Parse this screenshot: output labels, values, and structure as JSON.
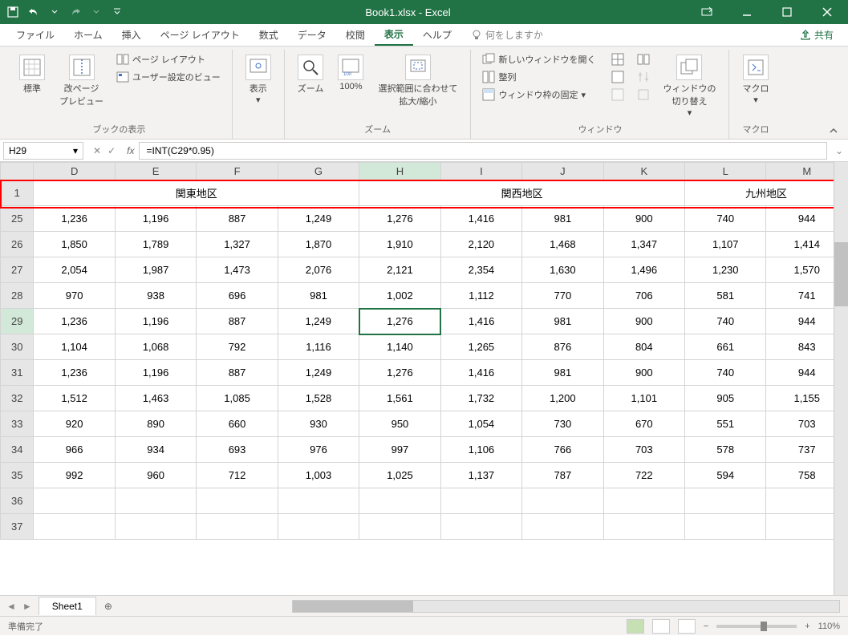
{
  "title": "Book1.xlsx - Excel",
  "menu": {
    "file": "ファイル",
    "home": "ホーム",
    "insert": "挿入",
    "pagelayout": "ページ レイアウト",
    "formulas": "数式",
    "data": "データ",
    "review": "校閲",
    "view": "表示",
    "help": "ヘルプ",
    "tellme": "何をしますか",
    "share": "共有"
  },
  "ribbon": {
    "normal": "標準",
    "pagebreak": "改ページ\nプレビュー",
    "pagelayout_btn": "ページ レイアウト",
    "custom_view": "ユーザー設定のビュー",
    "group_workbook": "ブックの表示",
    "show": "表示",
    "zoom": "ズーム",
    "hundred": "100%",
    "fit_selection": "選択範囲に合わせて\n拡大/縮小",
    "group_zoom": "ズーム",
    "new_window": "新しいウィンドウを開く",
    "arrange": "整列",
    "freeze": "ウィンドウ枠の固定",
    "group_window": "ウィンドウ",
    "switch_window": "ウィンドウの\n切り替え",
    "macro": "マクロ",
    "group_macro": "マクロ"
  },
  "namebox": "H29",
  "formula": "=INT(C29*0.95)",
  "columns": [
    "D",
    "E",
    "F",
    "G",
    "H",
    "I",
    "J",
    "K",
    "L",
    "M"
  ],
  "header_row": "1",
  "headers": {
    "kanto": "関東地区",
    "kansai": "関西地区",
    "kyushu": "九州地区"
  },
  "rows": [
    {
      "n": "25",
      "d": [
        "1,236",
        "1,196",
        "887",
        "1,249",
        "1,276",
        "1,416",
        "981",
        "900",
        "740",
        "944"
      ]
    },
    {
      "n": "26",
      "d": [
        "1,850",
        "1,789",
        "1,327",
        "1,870",
        "1,910",
        "2,120",
        "1,468",
        "1,347",
        "1,107",
        "1,414"
      ]
    },
    {
      "n": "27",
      "d": [
        "2,054",
        "1,987",
        "1,473",
        "2,076",
        "2,121",
        "2,354",
        "1,630",
        "1,496",
        "1,230",
        "1,570"
      ]
    },
    {
      "n": "28",
      "d": [
        "970",
        "938",
        "696",
        "981",
        "1,002",
        "1,112",
        "770",
        "706",
        "581",
        "741"
      ]
    },
    {
      "n": "29",
      "d": [
        "1,236",
        "1,196",
        "887",
        "1,249",
        "1,276",
        "1,416",
        "981",
        "900",
        "740",
        "944"
      ]
    },
    {
      "n": "30",
      "d": [
        "1,104",
        "1,068",
        "792",
        "1,116",
        "1,140",
        "1,265",
        "876",
        "804",
        "661",
        "843"
      ]
    },
    {
      "n": "31",
      "d": [
        "1,236",
        "1,196",
        "887",
        "1,249",
        "1,276",
        "1,416",
        "981",
        "900",
        "740",
        "944"
      ]
    },
    {
      "n": "32",
      "d": [
        "1,512",
        "1,463",
        "1,085",
        "1,528",
        "1,561",
        "1,732",
        "1,200",
        "1,101",
        "905",
        "1,155"
      ]
    },
    {
      "n": "33",
      "d": [
        "920",
        "890",
        "660",
        "930",
        "950",
        "1,054",
        "730",
        "670",
        "551",
        "703"
      ]
    },
    {
      "n": "34",
      "d": [
        "966",
        "934",
        "693",
        "976",
        "997",
        "1,106",
        "766",
        "703",
        "578",
        "737"
      ]
    },
    {
      "n": "35",
      "d": [
        "992",
        "960",
        "712",
        "1,003",
        "1,025",
        "1,137",
        "787",
        "722",
        "594",
        "758"
      ]
    },
    {
      "n": "36",
      "d": [
        "",
        "",
        "",
        "",
        "",
        "",
        "",
        "",
        "",
        ""
      ]
    },
    {
      "n": "37",
      "d": [
        "",
        "",
        "",
        "",
        "",
        "",
        "",
        "",
        "",
        ""
      ]
    }
  ],
  "sheet": "Sheet1",
  "status": "準備完了",
  "zoom": "110%"
}
